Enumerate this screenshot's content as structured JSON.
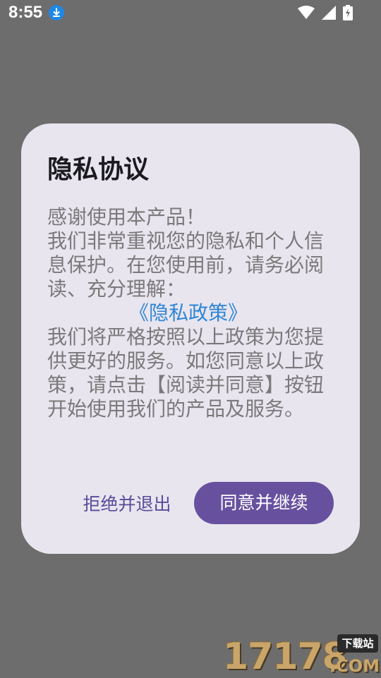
{
  "status_bar": {
    "time": "8:55",
    "icons": [
      "download-icon",
      "wifi-icon",
      "signal-icon",
      "battery-charging-icon"
    ]
  },
  "dialog": {
    "title": "隐私协议",
    "body_lines": [
      "感谢使用本产品！",
      "我们非常重视您的隐私和个人信息保护。在您使用前，请务必阅读、充分理解："
    ],
    "policy_link": "《隐私政策》",
    "body_after": "我们将严格按照以上政策为您提供更好的服务。如您同意以上政策，请点击【阅读并同意】按钮开始使用我们的产品及服务。",
    "decline_label": "拒绝并退出",
    "agree_label": "同意并继续"
  },
  "watermark": {
    "digits": "17178",
    "badge": "下载站",
    "suffix": ".COM"
  },
  "colors": {
    "scrim": "#6d6d6d",
    "dialog_bg": "#e9e5ef",
    "primary": "#67519f",
    "link": "#2f86d6",
    "body_text": "#7a7a7a"
  }
}
